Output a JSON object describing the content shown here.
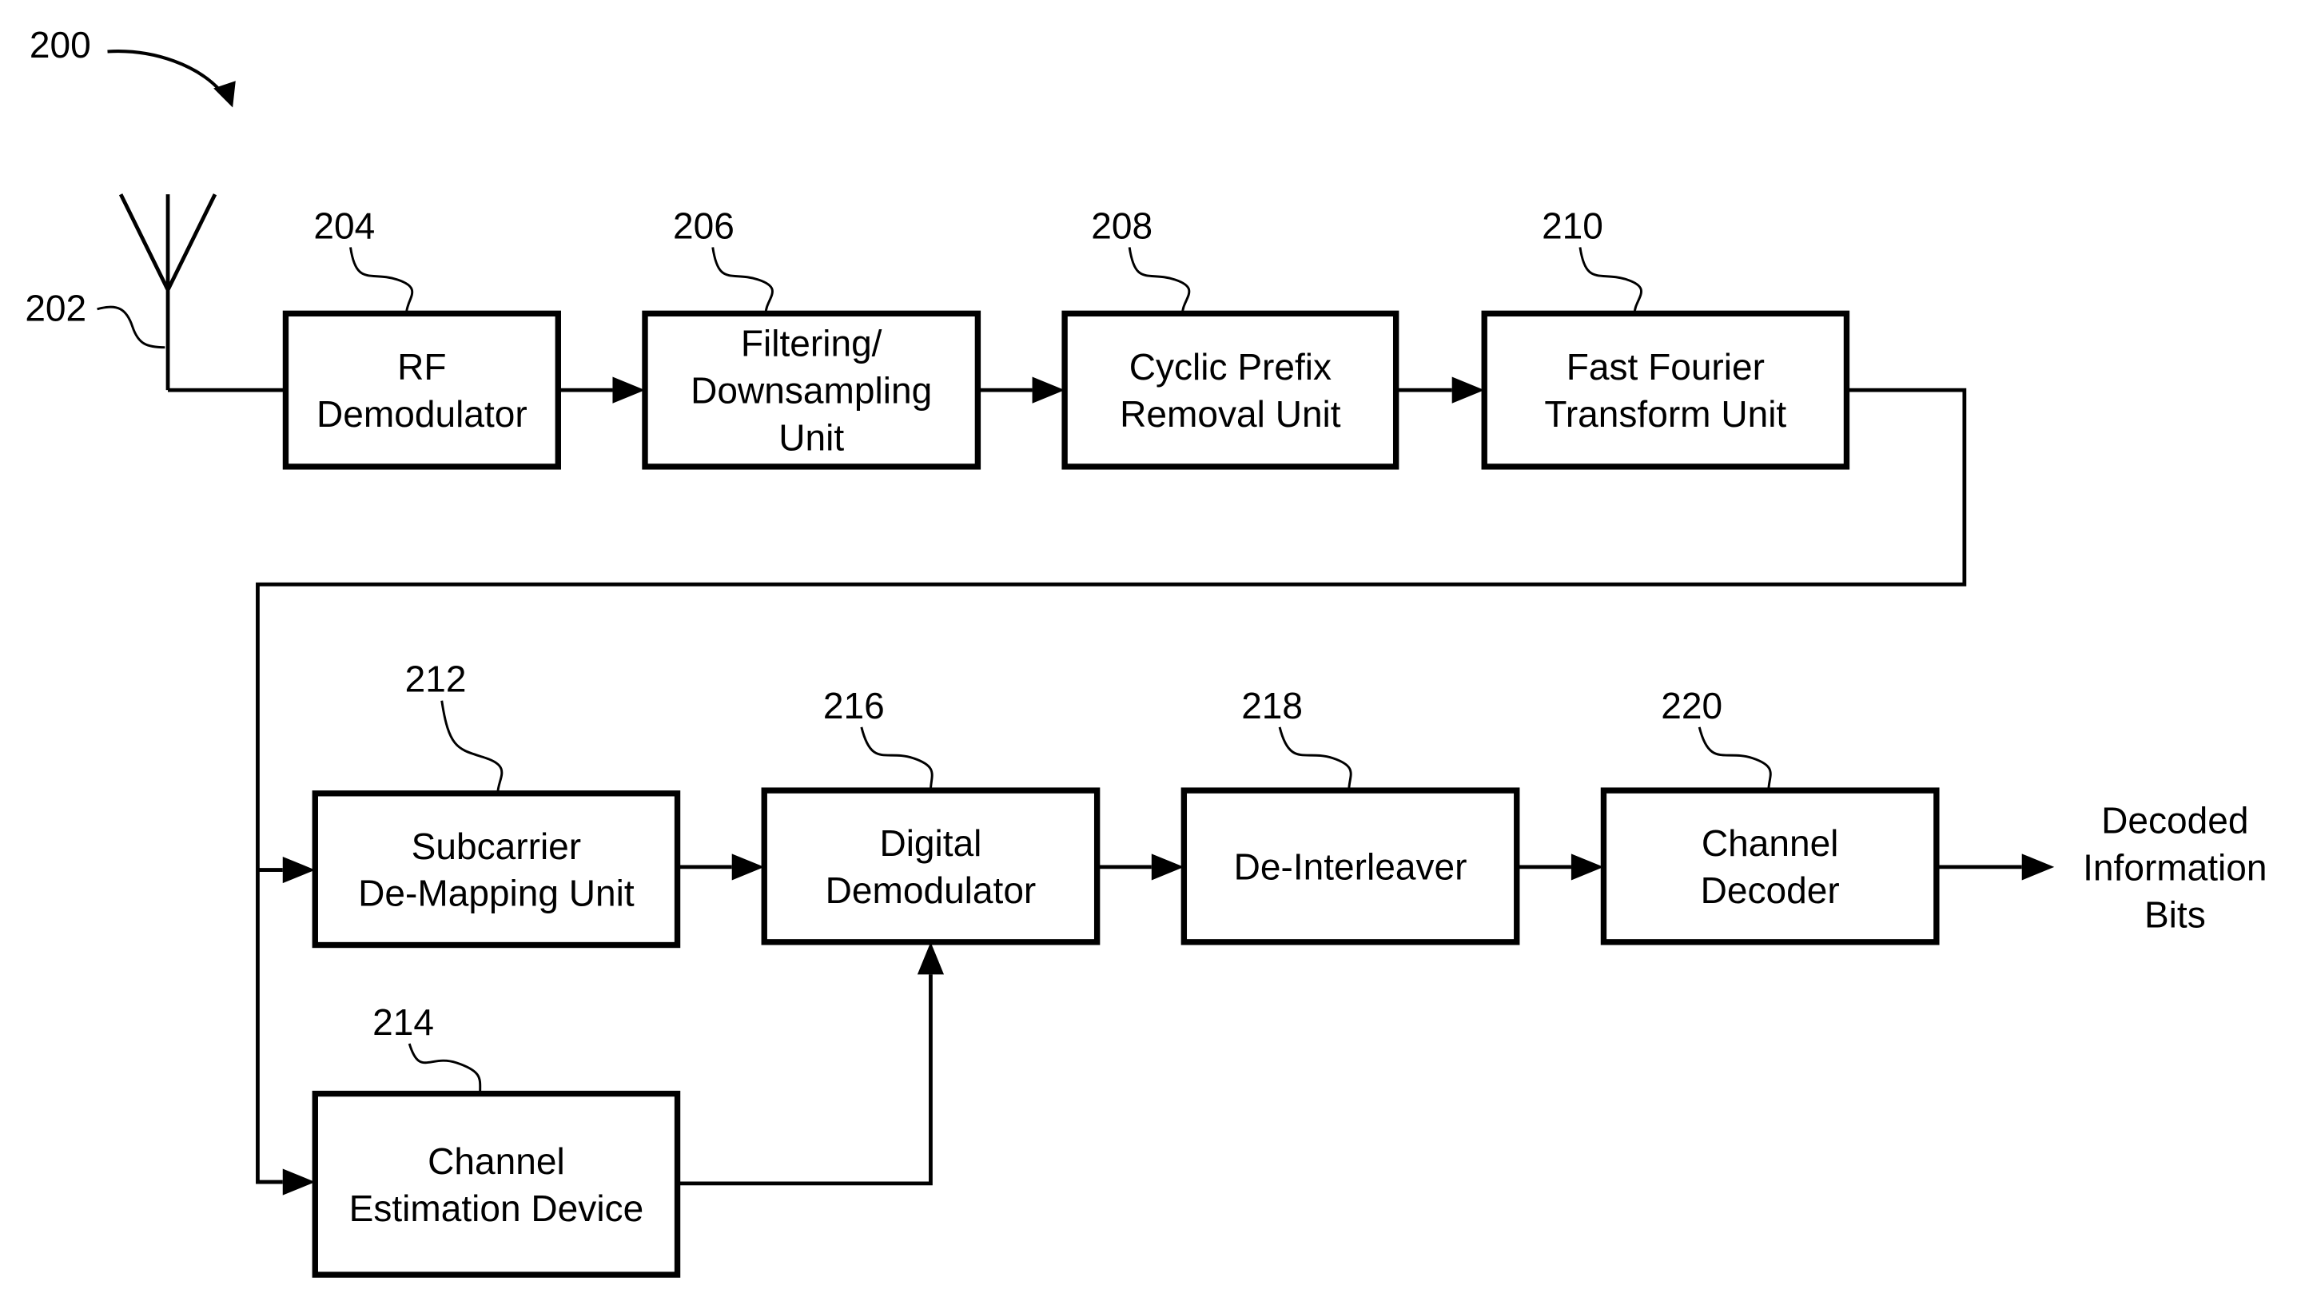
{
  "figure": {
    "figure_number": "200",
    "antenna_ref": "202",
    "output_label": [
      "Decoded",
      "Information",
      "Bits"
    ]
  },
  "blocks": [
    {
      "id": "rf-demodulator",
      "ref": "204",
      "lines": [
        "RF",
        "Demodulator"
      ]
    },
    {
      "id": "filtering-downsampling-unit",
      "ref": "206",
      "lines": [
        "Filtering/",
        "Downsampling",
        "Unit"
      ]
    },
    {
      "id": "cyclic-prefix-removal-unit",
      "ref": "208",
      "lines": [
        "Cyclic Prefix",
        "Removal Unit"
      ]
    },
    {
      "id": "fast-fourier-transform-unit",
      "ref": "210",
      "lines": [
        "Fast Fourier",
        "Transform Unit"
      ]
    },
    {
      "id": "subcarrier-de-mapping-unit",
      "ref": "212",
      "lines": [
        "Subcarrier",
        "De-Mapping Unit"
      ]
    },
    {
      "id": "channel-estimation-device",
      "ref": "214",
      "lines": [
        "Channel",
        "Estimation Device"
      ]
    },
    {
      "id": "digital-demodulator",
      "ref": "216",
      "lines": [
        "Digital",
        "Demodulator"
      ]
    },
    {
      "id": "de-interleaver",
      "ref": "218",
      "lines": [
        "De-Interleaver"
      ]
    },
    {
      "id": "channel-decoder",
      "ref": "220",
      "lines": [
        "Channel",
        "Decoder"
      ]
    }
  ],
  "connections": [
    {
      "from": "antenna",
      "to": "rf-demodulator"
    },
    {
      "from": "rf-demodulator",
      "to": "filtering-downsampling-unit"
    },
    {
      "from": "filtering-downsampling-unit",
      "to": "cyclic-prefix-removal-unit"
    },
    {
      "from": "cyclic-prefix-removal-unit",
      "to": "fast-fourier-transform-unit"
    },
    {
      "from": "fast-fourier-transform-unit",
      "to": "subcarrier-de-mapping-unit"
    },
    {
      "from": "fast-fourier-transform-unit",
      "to": "channel-estimation-device"
    },
    {
      "from": "subcarrier-de-mapping-unit",
      "to": "digital-demodulator"
    },
    {
      "from": "channel-estimation-device",
      "to": "digital-demodulator"
    },
    {
      "from": "digital-demodulator",
      "to": "de-interleaver"
    },
    {
      "from": "de-interleaver",
      "to": "channel-decoder"
    },
    {
      "from": "channel-decoder",
      "to": "output"
    }
  ]
}
